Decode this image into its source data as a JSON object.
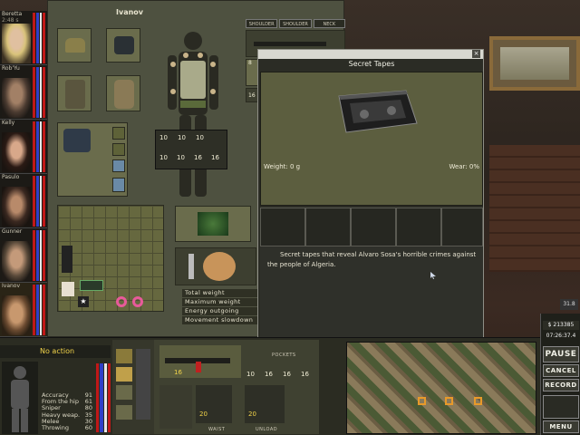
{
  "mercs": [
    {
      "name": "Beretta",
      "sub": "2:48 s"
    },
    {
      "name": "Rob'Yu",
      "sub": ""
    },
    {
      "name": "Kelly",
      "sub": ""
    },
    {
      "name": "Pasulo",
      "sub": ""
    },
    {
      "name": "Gunner",
      "sub": ""
    },
    {
      "name": "Ivanov",
      "sub": ""
    }
  ],
  "inventory": {
    "title": "Ivanov",
    "tabs": [
      "SHOULDER",
      "SHOULDER",
      "NECK"
    ],
    "ammo_top": [
      "10",
      "10",
      "10"
    ],
    "ammo_bottom": [
      "10",
      "10",
      "16",
      "16"
    ],
    "weights": [
      "Total weight",
      "Maximum weight",
      "Energy outgoing",
      "Movement slowdown"
    ],
    "mag_count": "16",
    "small_num": "8"
  },
  "popup": {
    "title": "Secret Tapes",
    "close": "×",
    "weight": "Weight: 0 g",
    "wear": "Wear: 0%",
    "description": "Secret tapes that reveal Alvaro Sosa's horrible crimes against the people of Algeria."
  },
  "hud": {
    "action": "No action",
    "stats": [
      {
        "label": "Accuracy",
        "value": "91"
      },
      {
        "label": "From the hip",
        "value": "61"
      },
      {
        "label": "Sniper",
        "value": "80"
      },
      {
        "label": "Heavy weap.",
        "value": "35"
      },
      {
        "label": "Melee",
        "value": "30"
      },
      {
        "label": "Throwing",
        "value": "60"
      }
    ],
    "pockets_label": "POCKETS",
    "waist_label": "WAIST",
    "unload_label": "UNLOAD",
    "ammo_counts": [
      "16",
      "10",
      "16",
      "16",
      "16",
      "20",
      "20"
    ]
  },
  "right_panel": {
    "money": "$ 213385",
    "time": "07:26:37.4",
    "buttons": [
      "PAUSE",
      "CANCEL",
      "RECORD",
      "MENU"
    ],
    "zoom": "31.8"
  }
}
